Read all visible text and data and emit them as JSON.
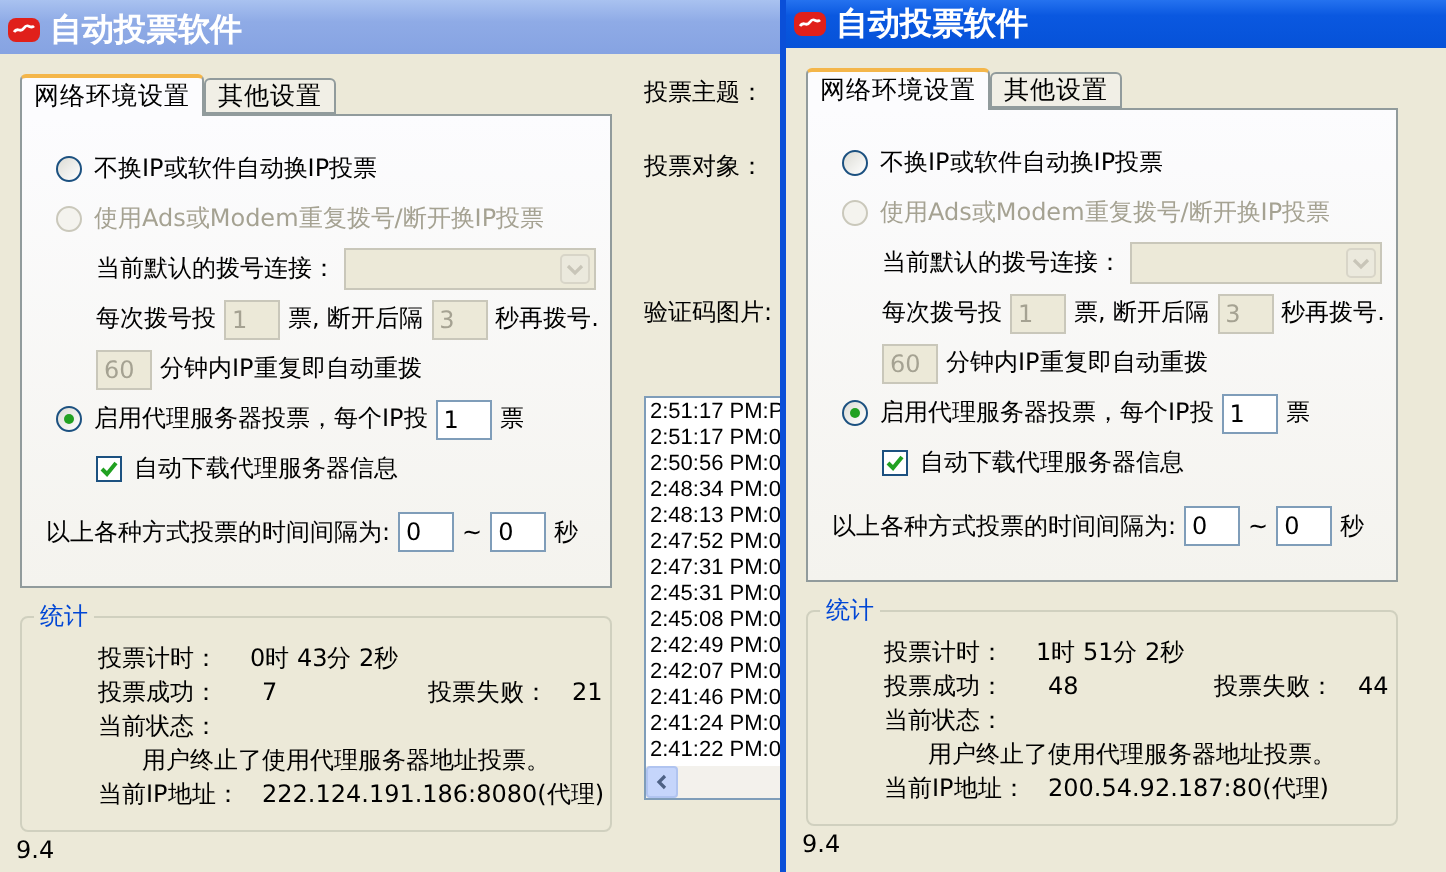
{
  "windows": [
    {
      "title": "自动投票软件",
      "active": false,
      "tabs": [
        {
          "label": "网络环境设置",
          "selected": true
        },
        {
          "label": "其他设置",
          "selected": false
        }
      ],
      "settings_rows": [
        {
          "kind": "option",
          "parts": [
            {
              "kind": "radio",
              "label": "不换IP或软件自动换IP投票",
              "selected": false,
              "disabled": false
            }
          ]
        },
        {
          "kind": "option",
          "parts": [
            {
              "kind": "radio",
              "label": "使用Ads或Modem重复拨号/断开换IP投票",
              "selected": false,
              "disabled": true
            }
          ]
        },
        {
          "kind": "sub",
          "parts": [
            {
              "kind": "text",
              "text": "当前默认的拨号连接："
            },
            {
              "kind": "select",
              "disabled": true
            }
          ]
        },
        {
          "kind": "sub",
          "parts": [
            {
              "kind": "text",
              "text": "每次拨号投"
            },
            {
              "kind": "input",
              "value": "1",
              "disabled": true
            },
            {
              "kind": "text",
              "text": "票, 断开后隔"
            },
            {
              "kind": "input",
              "value": "3",
              "disabled": true
            },
            {
              "kind": "text",
              "text": "秒再拨号."
            }
          ]
        },
        {
          "kind": "sub",
          "parts": [
            {
              "kind": "input",
              "value": "60",
              "disabled": true
            },
            {
              "kind": "text",
              "text": "分钟内IP重复即自动重拨"
            }
          ]
        },
        {
          "kind": "option",
          "parts": [
            {
              "kind": "radio",
              "label": "启用代理服务器投票，每个IP投",
              "selected": true,
              "disabled": false
            },
            {
              "kind": "input",
              "value": "1",
              "disabled": false
            },
            {
              "kind": "text",
              "text": "票"
            }
          ]
        },
        {
          "kind": "sub",
          "parts": [
            {
              "kind": "checkbox",
              "label": "自动下载代理服务器信息",
              "checked": true
            }
          ]
        },
        {
          "kind": "plain",
          "parts": [
            {
              "kind": "text",
              "text": "以上各种方式投票的时间间隔为:"
            },
            {
              "kind": "input",
              "value": "0",
              "disabled": false
            },
            {
              "kind": "text",
              "text": "~"
            },
            {
              "kind": "input",
              "value": "0",
              "disabled": false
            },
            {
              "kind": "text",
              "text": "秒"
            }
          ]
        }
      ],
      "stats": {
        "title": "统计",
        "elapsed_label": "投票计时：",
        "elapsed": "0时 43分 2秒",
        "success_label": "投票成功：",
        "success": "7",
        "fail_label": "投票失败：",
        "fail": "21",
        "status_label": "当前状态：",
        "status": "用户终止了使用代理服务器地址投票。",
        "ip_label": "当前IP地址：",
        "ip": "222.124.191.186:8080(代理)"
      },
      "version": "9.4",
      "fields": [
        "投票主题：",
        "投票对象：",
        "验证码图片:"
      ],
      "log": [
        "2:51:17 PM:P",
        "2:51:17 PM:0",
        "2:50:56 PM:0",
        "2:48:34 PM:0",
        "2:48:13 PM:0",
        "2:47:52 PM:0",
        "2:47:31 PM:0",
        "2:45:31 PM:0",
        "2:45:08 PM:0",
        "2:42:49 PM:0",
        "2:42:07 PM:0",
        "2:41:46 PM:0",
        "2:41:24 PM:0",
        "2:41:22 PM:0"
      ]
    },
    {
      "title": "自动投票软件",
      "active": true,
      "tabs": [
        {
          "label": "网络环境设置",
          "selected": true
        },
        {
          "label": "其他设置",
          "selected": false
        }
      ],
      "settings_rows": [
        {
          "kind": "option",
          "parts": [
            {
              "kind": "radio",
              "label": "不换IP或软件自动换IP投票",
              "selected": false,
              "disabled": false
            }
          ]
        },
        {
          "kind": "option",
          "parts": [
            {
              "kind": "radio",
              "label": "使用Ads或Modem重复拨号/断开换IP投票",
              "selected": false,
              "disabled": true
            }
          ]
        },
        {
          "kind": "sub",
          "parts": [
            {
              "kind": "text",
              "text": "当前默认的拨号连接："
            },
            {
              "kind": "select",
              "disabled": true
            }
          ]
        },
        {
          "kind": "sub",
          "parts": [
            {
              "kind": "text",
              "text": "每次拨号投"
            },
            {
              "kind": "input",
              "value": "1",
              "disabled": true
            },
            {
              "kind": "text",
              "text": "票, 断开后隔"
            },
            {
              "kind": "input",
              "value": "3",
              "disabled": true
            },
            {
              "kind": "text",
              "text": "秒再拨号."
            }
          ]
        },
        {
          "kind": "sub",
          "parts": [
            {
              "kind": "input",
              "value": "60",
              "disabled": true
            },
            {
              "kind": "text",
              "text": "分钟内IP重复即自动重拨"
            }
          ]
        },
        {
          "kind": "option",
          "parts": [
            {
              "kind": "radio",
              "label": "启用代理服务器投票，每个IP投",
              "selected": true,
              "disabled": false
            },
            {
              "kind": "input",
              "value": "1",
              "disabled": false
            },
            {
              "kind": "text",
              "text": "票"
            }
          ]
        },
        {
          "kind": "sub",
          "parts": [
            {
              "kind": "checkbox",
              "label": "自动下载代理服务器信息",
              "checked": true
            }
          ]
        },
        {
          "kind": "plain",
          "parts": [
            {
              "kind": "text",
              "text": "以上各种方式投票的时间间隔为:"
            },
            {
              "kind": "input",
              "value": "0",
              "disabled": false
            },
            {
              "kind": "text",
              "text": "~"
            },
            {
              "kind": "input",
              "value": "0",
              "disabled": false
            },
            {
              "kind": "text",
              "text": "秒"
            }
          ]
        }
      ],
      "stats": {
        "title": "统计",
        "elapsed_label": "投票计时：",
        "elapsed": "1时 51分 2秒",
        "success_label": "投票成功：",
        "success": "48",
        "fail_label": "投票失败：",
        "fail": "44",
        "status_label": "当前状态：",
        "status": "用户终止了使用代理服务器地址投票。",
        "ip_label": "当前IP地址：",
        "ip": "200.54.92.187:80(代理)"
      },
      "version": "9.4"
    }
  ]
}
